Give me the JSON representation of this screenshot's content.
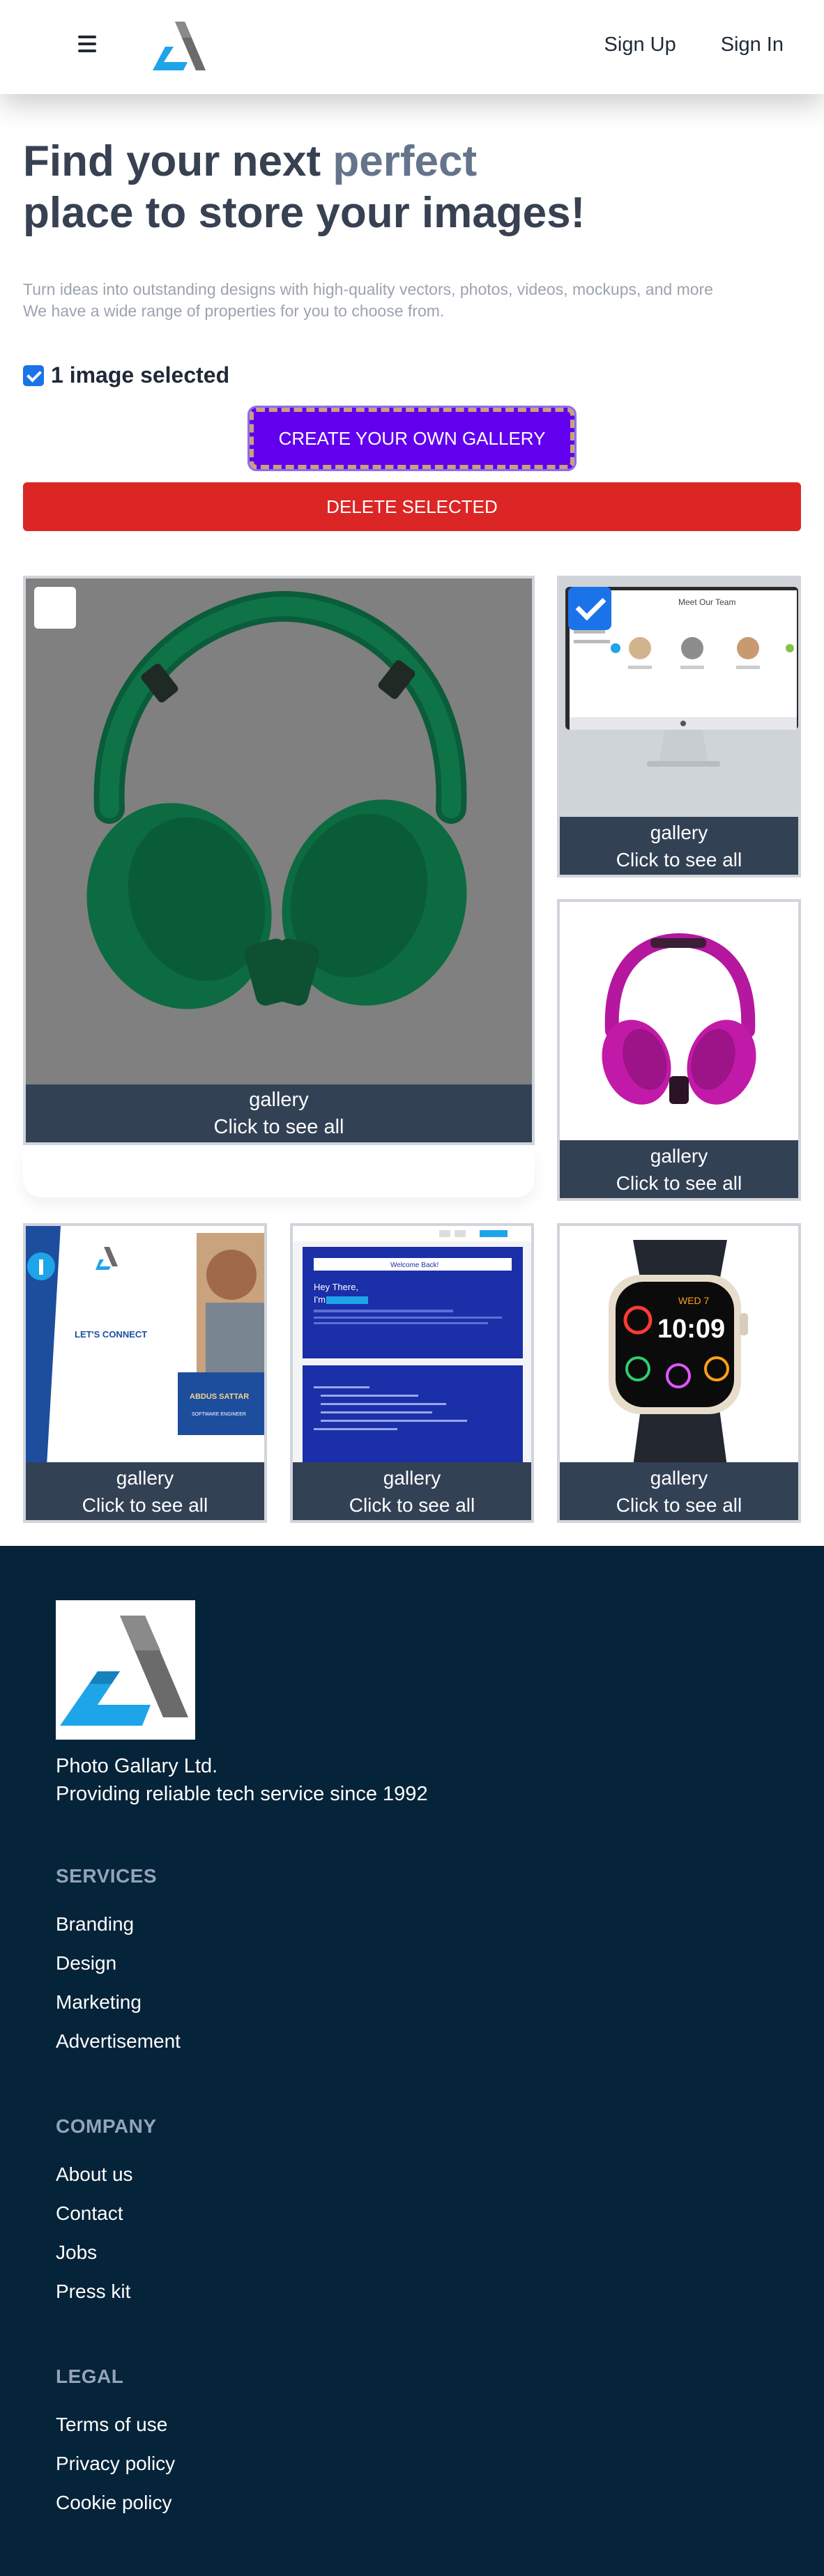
{
  "nav": {
    "logo_icon": "delta-logo",
    "sign_up": "Sign Up",
    "sign_in": "Sign In"
  },
  "hero": {
    "title_part1": "Find your next ",
    "title_accent": "perfect",
    "title_part2": "place to store your images!",
    "subtitle_line1": "Turn ideas into outstanding designs with high-quality vectors, photos, videos, mockups, and more",
    "subtitle_line2": "We have a wide range of properties for you to choose from.",
    "accent_color": "#64748b"
  },
  "selection": {
    "status": "1 image selected",
    "checked": true
  },
  "actions": {
    "create_label": "CREATE YOUR OWN GALLERY",
    "delete_label": "DELETE SELECTED",
    "create_color": "#6200ee",
    "delete_color": "#dc2626"
  },
  "gallery": [
    {
      "caption": "gallery",
      "cta": "Click to see all",
      "selected": false,
      "subject": "green-headphones"
    },
    {
      "caption": "gallery",
      "cta": "Click to see all",
      "selected": true,
      "subject": "imac-team-page",
      "screen_text": {
        "title": "Meet Our Team"
      }
    },
    {
      "caption": "gallery",
      "cta": "Click to see all",
      "selected": false,
      "subject": "magenta-headphones"
    },
    {
      "caption": "gallery",
      "cta": "Click to see all",
      "selected": false,
      "subject": "lets-connect-card",
      "screen_text": {
        "headline": "LET'S CONNECT",
        "name": "ABDUS SATTAR",
        "role": "SOFTWARE ENGINEER"
      }
    },
    {
      "caption": "gallery",
      "cta": "Click to see all",
      "selected": false,
      "subject": "portfolio-screens",
      "screen_text": {
        "banner": "Welcome Back!",
        "greeting": "Hey There,",
        "intro": "I'm"
      }
    },
    {
      "caption": "gallery",
      "cta": "Click to see all",
      "selected": false,
      "subject": "smartwatch",
      "screen_text": {
        "date": "WED 7",
        "time": "10:09"
      }
    }
  ],
  "footer": {
    "company_name": "Photo Gallary Ltd.",
    "tagline": "Providing reliable tech service since 1992",
    "services": {
      "title": "SERVICES",
      "links": [
        "Branding",
        "Design",
        "Marketing",
        "Advertisement"
      ]
    },
    "company": {
      "title": "COMPANY",
      "links": [
        "About us",
        "Contact",
        "Jobs",
        "Press kit"
      ]
    },
    "legal": {
      "title": "LEGAL",
      "links": [
        "Terms of use",
        "Privacy policy",
        "Cookie policy"
      ]
    },
    "background": "#052339"
  }
}
